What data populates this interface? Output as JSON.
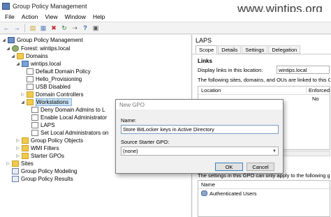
{
  "window": {
    "title": "Group Policy Management"
  },
  "watermark": "www.wintips.org",
  "menu": [
    "File",
    "Action",
    "View",
    "Window",
    "Help"
  ],
  "toolbar": {
    "icons": [
      "back-arrow-icon",
      "forward-arrow-icon",
      "folder-up-icon",
      "show-hide-tree-icon",
      "delete-icon",
      "refresh-icon",
      "export-icon",
      "help-icon",
      "properties-icon"
    ],
    "glyphs": [
      "←",
      "→",
      "▤",
      "▦",
      "✖",
      "↻",
      "⇢",
      "?",
      "▣"
    ]
  },
  "tree": {
    "items": [
      {
        "label": "Group Policy Management",
        "icon": "management-icon"
      },
      {
        "label": "Forest: wintips.local",
        "icon": "forest-icon"
      },
      {
        "label": "Domains",
        "icon": "folder-icon"
      },
      {
        "label": "wintips.local",
        "icon": "domain-icon"
      },
      {
        "label": "Default Domain Policy",
        "icon": "gpo-link-icon"
      },
      {
        "label": "Hello_Provisioning",
        "icon": "gpo-link-icon"
      },
      {
        "label": "USB Disabled",
        "icon": "gpo-link-icon"
      },
      {
        "label": "Domain Controllers",
        "icon": "folder-icon"
      },
      {
        "label": "Workstations",
        "icon": "folder-icon"
      },
      {
        "label": "Deny Domain Admins to L",
        "icon": "gpo-link-icon"
      },
      {
        "label": "Enable Local Administrator",
        "icon": "gpo-link-icon"
      },
      {
        "label": "LAPS",
        "icon": "gpo-link-icon"
      },
      {
        "label": "Set Local Administrators on",
        "icon": "gpo-link-icon"
      },
      {
        "label": "Group Policy Objects",
        "icon": "folder-icon"
      },
      {
        "label": "WMI Filters",
        "icon": "folder-icon"
      },
      {
        "label": "Starter GPOs",
        "icon": "folder-icon"
      },
      {
        "label": "Sites",
        "icon": "folder-icon"
      },
      {
        "label": "Group Policy Modeling",
        "icon": "modeling-icon"
      },
      {
        "label": "Group Policy Results",
        "icon": "results-icon"
      }
    ]
  },
  "right_pane": {
    "title": "LAPS",
    "tabs": [
      "Scope",
      "Details",
      "Settings",
      "Delegation"
    ],
    "links_heading": "Links",
    "display_links_label": "Display links in this location:",
    "display_links_value": "wintips.local",
    "following_text": "The following sites, domains, and OUs are linked to this GPO:",
    "link_columns": [
      "Location",
      "Enforced"
    ],
    "link_rows": [
      {
        "location": "",
        "enforced": "No"
      }
    ],
    "filter_text": "The settings in this GPO can only apply to the following groups, users,",
    "filter_column": "Name",
    "filter_rows": [
      "Authenticated Users"
    ]
  },
  "dialog": {
    "title": "New GPO",
    "name_label": "Name:",
    "name_value": "Store BitLocker keys in Active Directory",
    "starter_label": "Source Starter GPO:",
    "starter_value": "(none)",
    "ok_label": "OK",
    "cancel_label": "Cancel"
  }
}
